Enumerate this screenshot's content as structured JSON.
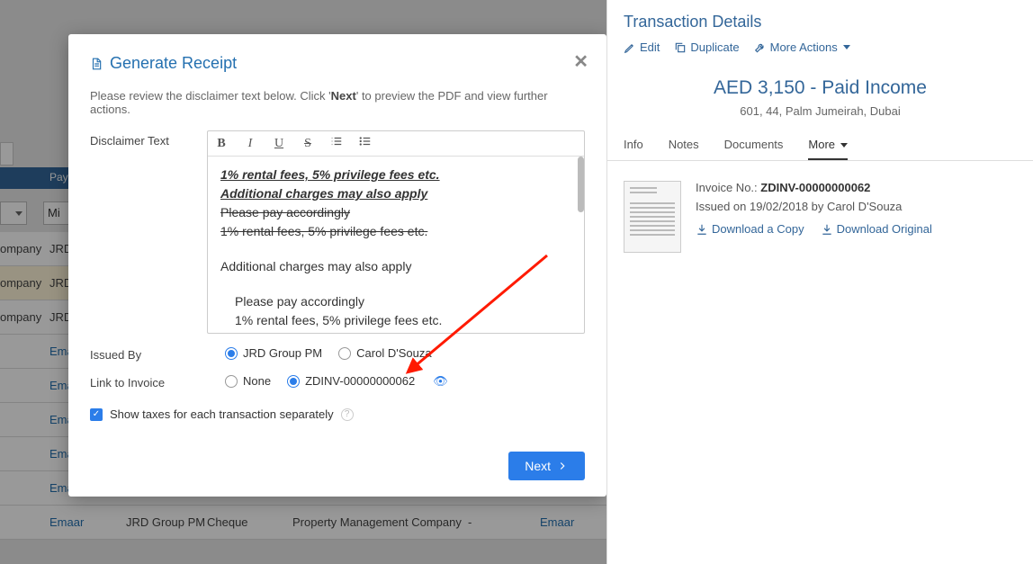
{
  "modal": {
    "title": "Generate Receipt",
    "subtitle_pre": "Please review the disclaimer text below. Click '",
    "subtitle_bold": "Next",
    "subtitle_post": "' to preview the PDF and view further actions.",
    "disclaimer_label": "Disclaimer Text",
    "editor_lines": {
      "l1": "1% rental fees, 5% privilege fees etc.",
      "l2": "Additional charges may also apply",
      "l3": "Please pay accordingly",
      "l4": "1% rental fees, 5% privilege fees etc.",
      "l5": "Additional charges may also apply",
      "l6": "Please pay accordingly",
      "l7": "1% rental fees, 5% privilege fees etc."
    },
    "issued_by_label": "Issued By",
    "issued_by_opts": {
      "a": "JRD Group PM",
      "b": "Carol D'Souza"
    },
    "link_invoice_label": "Link to Invoice",
    "link_invoice_opts": {
      "a": "None",
      "b": "ZDINV-00000000062"
    },
    "show_taxes_label": "Show taxes for each transaction separately",
    "next_btn": "Next"
  },
  "bg": {
    "header_col": "Pay",
    "filter_inp": "Mi",
    "cell_company": "ompany",
    "cell_jrd": "JRD",
    "cell_emaar": "Emaar",
    "cell_jrdgroup": "JRD Group PM",
    "cell_cheque": "Cheque",
    "cell_pmc": "Property Management Company",
    "cell_dash": "-"
  },
  "right": {
    "title": "Transaction Details",
    "actions": {
      "edit": "Edit",
      "duplicate": "Duplicate",
      "more": "More Actions"
    },
    "amount": "AED 3,150 - Paid Income",
    "location": "601, 44, Palm Jumeirah, Dubai",
    "tabs": {
      "info": "Info",
      "notes": "Notes",
      "docs": "Documents",
      "more": "More"
    },
    "doc": {
      "invoice_label": "Invoice No.: ",
      "invoice_no": "ZDINV-00000000062",
      "issued": "Issued on 19/02/2018 by Carol D'Souza",
      "dl_copy": "Download a Copy",
      "dl_orig": "Download Original"
    }
  }
}
